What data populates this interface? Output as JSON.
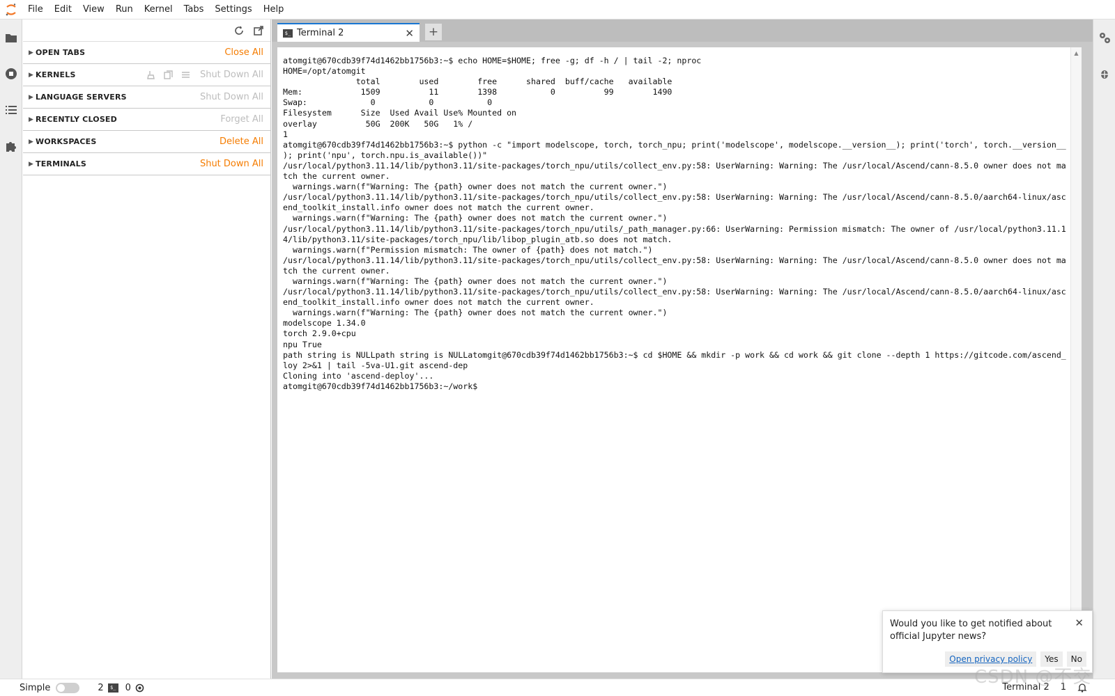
{
  "menubar": {
    "items": [
      "File",
      "Edit",
      "View",
      "Run",
      "Kernel",
      "Tabs",
      "Settings",
      "Help"
    ]
  },
  "sidebar": {
    "sections": [
      {
        "title": "OPEN TABS",
        "action": "Close All",
        "enabled": true
      },
      {
        "title": "KERNELS",
        "action": "Shut Down All",
        "enabled": false
      },
      {
        "title": "LANGUAGE SERVERS",
        "action": "Shut Down All",
        "enabled": false
      },
      {
        "title": "RECENTLY CLOSED",
        "action": "Forget All",
        "enabled": false
      },
      {
        "title": "WORKSPACES",
        "action": "Delete All",
        "enabled": true
      },
      {
        "title": "TERMINALS",
        "action": "Shut Down All",
        "enabled": true
      }
    ]
  },
  "tabs": {
    "active_label": "Terminal 2",
    "term_icon_text": "$_"
  },
  "terminal": {
    "lines": [
      "atomgit@670cdb39f74d1462bb1756b3:~$ echo HOME=$HOME; free -g; df -h / | tail -2; nproc",
      "HOME=/opt/atomgit",
      "               total        used        free      shared  buff/cache   available",
      "Mem:            1509          11        1398           0          99        1490",
      "Swap:             0           0           0",
      "Filesystem      Size  Used Avail Use% Mounted on",
      "overlay          50G  200K   50G   1% /",
      "1",
      "atomgit@670cdb39f74d1462bb1756b3:~$ python -c \"import modelscope, torch, torch_npu; print('modelscope', modelscope.__version__); print('torch', torch.__version__",
      "); print('npu', torch.npu.is_available())\"",
      "/usr/local/python3.11.14/lib/python3.11/site-packages/torch_npu/utils/collect_env.py:58: UserWarning: Warning: The /usr/local/Ascend/cann-8.5.0 owner does not ma",
      "tch the current owner.",
      "  warnings.warn(f\"Warning: The {path} owner does not match the current owner.\")",
      "/usr/local/python3.11.14/lib/python3.11/site-packages/torch_npu/utils/collect_env.py:58: UserWarning: Warning: The /usr/local/Ascend/cann-8.5.0/aarch64-linux/asc",
      "end_toolkit_install.info owner does not match the current owner.",
      "  warnings.warn(f\"Warning: The {path} owner does not match the current owner.\")",
      "/usr/local/python3.11.14/lib/python3.11/site-packages/torch_npu/utils/_path_manager.py:66: UserWarning: Permission mismatch: The owner of /usr/local/python3.11.1",
      "4/lib/python3.11/site-packages/torch_npu/lib/libop_plugin_atb.so does not match.",
      "  warnings.warn(f\"Permission mismatch: The owner of {path} does not match.\")",
      "/usr/local/python3.11.14/lib/python3.11/site-packages/torch_npu/utils/collect_env.py:58: UserWarning: Warning: The /usr/local/Ascend/cann-8.5.0 owner does not ma",
      "tch the current owner.",
      "  warnings.warn(f\"Warning: The {path} owner does not match the current owner.\")",
      "/usr/local/python3.11.14/lib/python3.11/site-packages/torch_npu/utils/collect_env.py:58: UserWarning: Warning: The /usr/local/Ascend/cann-8.5.0/aarch64-linux/asc",
      "end_toolkit_install.info owner does not match the current owner.",
      "  warnings.warn(f\"Warning: The {path} owner does not match the current owner.\")",
      "modelscope 1.34.0",
      "torch 2.9.0+cpu",
      "npu True",
      "path string is NULLpath string is NULLatomgit@670cdb39f74d1462bb1756b3:~$ cd $HOME && mkdir -p work && cd work && git clone --depth 1 https://gitcode.com/ascend_",
      "loy 2>&1 | tail -5va-U1.git ascend-dep",
      "Cloning into 'ascend-deploy'...",
      "atomgit@670cdb39f74d1462bb1756b3:~/work$"
    ]
  },
  "notification": {
    "message": "Would you like to get notified about official Jupyter news?",
    "privacy_link": "Open privacy policy",
    "yes_label": "Yes",
    "no_label": "No"
  },
  "statusbar": {
    "mode_label": "Simple",
    "terminal_count": "2",
    "kernel_count": "0",
    "active_doc": "Terminal 2",
    "line_info": "1"
  },
  "watermark": "CSDN @不交",
  "colors": {
    "accent": "#1976d2",
    "action_orange": "#f57c00",
    "jupyter_orange": "#f37726"
  }
}
